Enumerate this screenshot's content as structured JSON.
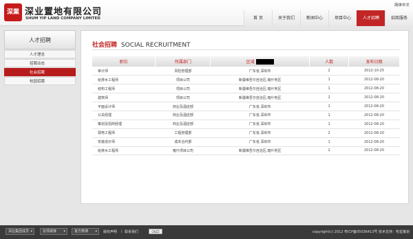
{
  "header": {
    "logo_text": "深業",
    "company_cn": "深业置地有限公司",
    "company_en": "SHUM YIP LAND COMPANY LIMITED",
    "lang_link": "简体中文",
    "nav": [
      {
        "label": "首 页"
      },
      {
        "label": "关于我们"
      },
      {
        "label": "新闻中心"
      },
      {
        "label": "项目中心"
      },
      {
        "label": "人才招聘"
      },
      {
        "label": "招商服务"
      }
    ],
    "active_nav_index": 4
  },
  "sidebar": {
    "title": "人才招聘",
    "items": [
      {
        "label": "人才理念"
      },
      {
        "label": "招聘动态"
      },
      {
        "label": "社会招聘"
      },
      {
        "label": "校园招聘"
      }
    ],
    "active_index": 2
  },
  "main": {
    "title_cn": "社会招聘",
    "title_en": "SOCIAL RECRUITMENT",
    "columns": {
      "title": "职位",
      "dept": "所属部门",
      "region": "区域",
      "count": "人数",
      "date": "发布日期"
    },
    "rows": [
      {
        "title": "审计师",
        "dept": "风险管理部",
        "region": "广东省,深圳市",
        "count": "2",
        "date": "2012-10-25"
      },
      {
        "title": "给排水工程师",
        "dept": "项目公司",
        "region": "新疆维吾尔自治区,喀什地区",
        "count": "1",
        "date": "2012-08-20"
      },
      {
        "title": "结构工程师",
        "dept": "项目公司",
        "region": "新疆维吾尔自治区,喀什地区",
        "count": "1",
        "date": "2012-08-20"
      },
      {
        "title": "建筑师",
        "dept": "项目公司",
        "region": "新疆维吾尔自治区,喀什地区",
        "count": "2",
        "date": "2012-08-20"
      },
      {
        "title": "平面设计师",
        "dept": "商业及酒店部",
        "region": "广东省,深圳市",
        "count": "1",
        "date": "2012-08-20"
      },
      {
        "title": "公关经理",
        "dept": "商业及酒店部",
        "region": "广东省,深圳市",
        "count": "1",
        "date": "2012-08-20"
      },
      {
        "title": "策划及招商经理",
        "dept": "商业及酒店部",
        "region": "广东省,深圳市",
        "count": "1",
        "date": "2012-08-20"
      },
      {
        "title": "弱电工程师",
        "dept": "工程管理部",
        "region": "广东省,深圳市",
        "count": "2",
        "date": "2012-08-20"
      },
      {
        "title": "安装造价师",
        "dept": "成本合约部",
        "region": "广东省,深圳市",
        "count": "1",
        "date": "2012-08-20"
      },
      {
        "title": "给排水工程师",
        "dept": "喀什项目公司",
        "region": "新疆维吾尔自治区,喀什地区",
        "count": "2",
        "date": "2012-08-20"
      }
    ]
  },
  "footer": {
    "select1": "深业集团成员",
    "select2": "友情链接",
    "select3": "官方微博",
    "link_disclaimer": "版权声明",
    "link_contact": "联系我们",
    "cnzz": "CNZZ",
    "copyright": "copyright(c)  2012  粤ICP备05036413号  技术支持：牧星策划"
  }
}
